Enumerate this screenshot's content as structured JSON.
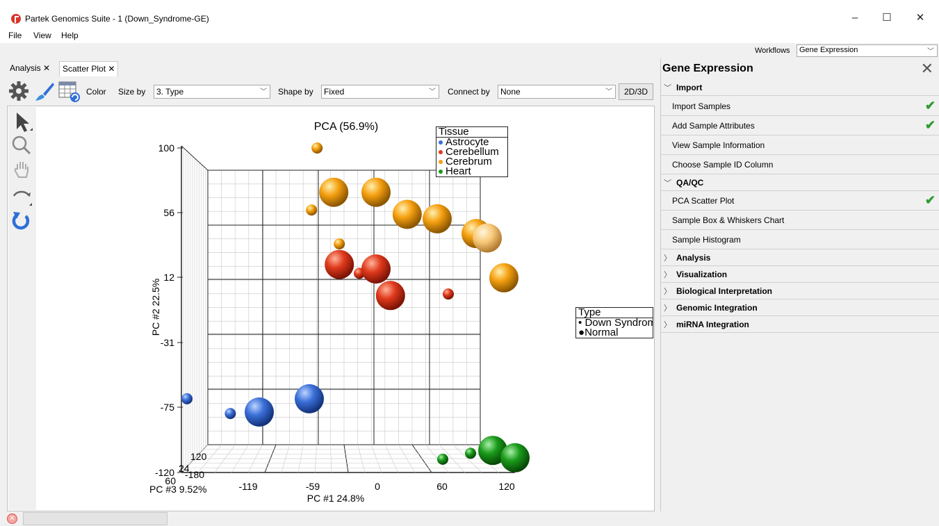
{
  "window": {
    "title": "Partek Genomics Suite - 1 (Down_Syndrome-GE)",
    "minimize": "–",
    "maximize": "☐",
    "close": "✕"
  },
  "menu": [
    "File",
    "View",
    "Help"
  ],
  "workflows": {
    "label": "Workflows",
    "value": "Gene Expression"
  },
  "tabs": [
    {
      "label": "Analysis ✕"
    },
    {
      "label": "Scatter Plot ✕"
    }
  ],
  "toolbar": {
    "color_label": "Color",
    "size_by_label": "Size by",
    "size_by_value": "3. Type",
    "shape_by_label": "Shape by",
    "shape_by_value": "Fixed",
    "connect_by_label": "Connect by",
    "connect_by_value": "None",
    "view_toggle": "2D/3D"
  },
  "plot": {
    "title": "PCA (56.9%)",
    "xlabel": "PC #1 24.8%",
    "ylabel": "PC #2 22.5%",
    "zlabel": "PC #3 9.52%",
    "x_ticks": [
      "-119",
      "-59",
      "0",
      "60",
      "120"
    ],
    "y_ticks": [
      "100",
      "56",
      "12",
      "-31",
      "-75",
      "-120"
    ],
    "z_tick_fragments": [
      "60",
      "-180",
      "24",
      "120"
    ]
  },
  "legend_tissue": {
    "title": "Tissue",
    "items": [
      {
        "label": "Astrocyte",
        "color": "#3b6fd8"
      },
      {
        "label": "Cerebellum",
        "color": "#e03a1c"
      },
      {
        "label": "Cerebrum",
        "color": "#f5a010"
      },
      {
        "label": "Heart",
        "color": "#1a9a1a"
      }
    ]
  },
  "legend_type": {
    "title": "Type",
    "items": [
      {
        "label": "Down Syndrome",
        "marker": "•"
      },
      {
        "label": "Normal",
        "marker": "●"
      }
    ]
  },
  "chart_data": {
    "type": "scatter",
    "title": "PCA (56.9%)",
    "xlabel": "PC #1 24.8%",
    "ylabel": "PC #2 22.5%",
    "zlabel": "PC #3 9.52%",
    "xlim": [
      -180,
      120
    ],
    "ylim": [
      -120,
      100
    ],
    "series": [
      {
        "name": "Astrocyte",
        "color": "#3b6fd8",
        "points": [
          {
            "x": -175,
            "y": -70,
            "size": "small"
          },
          {
            "x": -136,
            "y": -80,
            "size": "small"
          },
          {
            "x": -110,
            "y": -79,
            "size": "large"
          },
          {
            "x": -65,
            "y": -70,
            "size": "large"
          }
        ]
      },
      {
        "name": "Cerebellum",
        "color": "#e03a1c",
        "points": [
          {
            "x": -38,
            "y": 21,
            "size": "large"
          },
          {
            "x": -20,
            "y": 15,
            "size": "small"
          },
          {
            "x": -5,
            "y": 18,
            "size": "large"
          },
          {
            "x": 8,
            "y": 0,
            "size": "large"
          },
          {
            "x": 60,
            "y": 1,
            "size": "small"
          }
        ]
      },
      {
        "name": "Cerebrum",
        "color": "#f5a010",
        "points": [
          {
            "x": -58,
            "y": 100,
            "size": "small"
          },
          {
            "x": -63,
            "y": 58,
            "size": "small"
          },
          {
            "x": -43,
            "y": 70,
            "size": "large"
          },
          {
            "x": -5,
            "y": 70,
            "size": "large"
          },
          {
            "x": -38,
            "y": 35,
            "size": "small"
          },
          {
            "x": 23,
            "y": 55,
            "size": "large"
          },
          {
            "x": 50,
            "y": 52,
            "size": "large"
          },
          {
            "x": 85,
            "y": 42,
            "size": "large"
          },
          {
            "x": 95,
            "y": 39,
            "size": "large"
          },
          {
            "x": 110,
            "y": 12,
            "size": "large"
          }
        ]
      },
      {
        "name": "Heart",
        "color": "#1a9a1a",
        "points": [
          {
            "x": 55,
            "y": -111,
            "size": "small"
          },
          {
            "x": 80,
            "y": -107,
            "size": "small"
          },
          {
            "x": 100,
            "y": -105,
            "size": "large"
          },
          {
            "x": 120,
            "y": -110,
            "size": "large"
          }
        ]
      }
    ]
  },
  "panel": {
    "title": "Gene Expression",
    "sections": [
      {
        "label": "Import",
        "expanded": true,
        "steps": [
          {
            "label": "Import Samples",
            "done": true
          },
          {
            "label": "Add Sample Attributes",
            "done": true
          },
          {
            "label": "View Sample Information",
            "done": false
          },
          {
            "label": "Choose Sample ID Column",
            "done": false
          }
        ]
      },
      {
        "label": "QA/QC",
        "expanded": true,
        "steps": [
          {
            "label": "PCA Scatter Plot",
            "done": true
          },
          {
            "label": "Sample Box & Whiskers Chart",
            "done": false
          },
          {
            "label": "Sample Histogram",
            "done": false
          }
        ]
      },
      {
        "label": "Analysis",
        "expanded": false,
        "steps": []
      },
      {
        "label": "Visualization",
        "expanded": false,
        "steps": []
      },
      {
        "label": "Biological Interpretation",
        "expanded": false,
        "steps": []
      },
      {
        "label": "Genomic Integration",
        "expanded": false,
        "steps": []
      },
      {
        "label": "miRNA Integration",
        "expanded": false,
        "steps": []
      }
    ]
  },
  "status": {
    "error_icon": "✕"
  }
}
